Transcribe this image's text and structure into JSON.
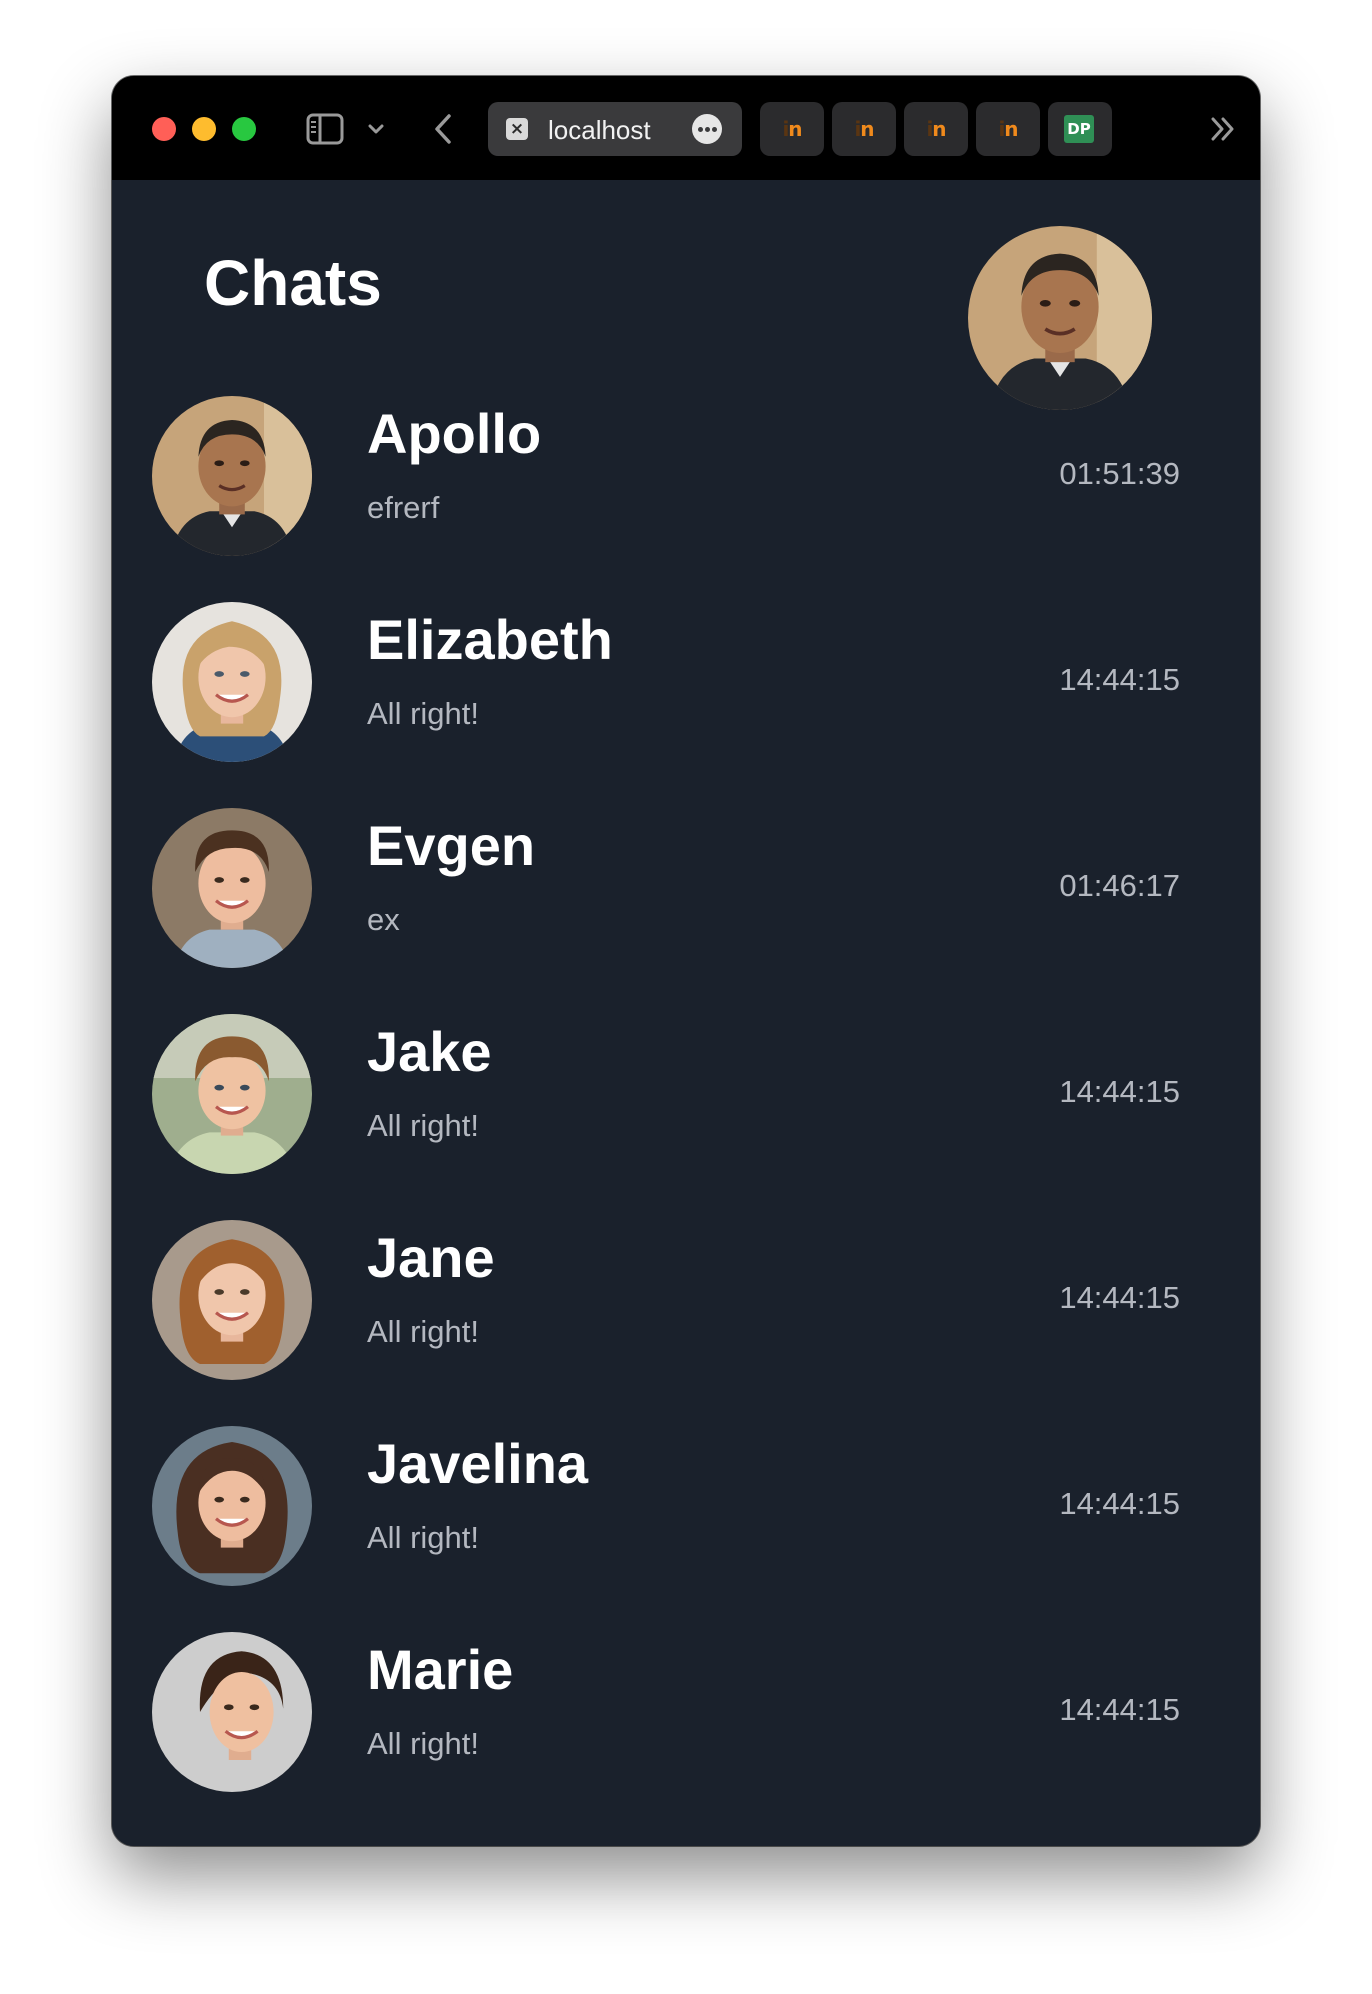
{
  "browser": {
    "active_tab": {
      "title": "localhost",
      "favicon": "close-x-icon"
    },
    "pinned_tabs": [
      {
        "icon": "invision-icon"
      },
      {
        "icon": "invision-icon"
      },
      {
        "icon": "invision-icon"
      },
      {
        "icon": "invision-icon"
      },
      {
        "icon": "dp-icon",
        "label": "DP"
      }
    ],
    "colors": {
      "titlebar": "#000000",
      "close": "#ff5f57",
      "minimize": "#febc2e",
      "zoom": "#28c840"
    }
  },
  "page": {
    "title": "Chats",
    "background": "#1a212c"
  },
  "chats": [
    {
      "name": "Apollo",
      "preview": "efrerf",
      "time": "01:51:39"
    },
    {
      "name": "Elizabeth",
      "preview": "All right!",
      "time": "14:44:15"
    },
    {
      "name": "Evgen",
      "preview": "ex",
      "time": "01:46:17"
    },
    {
      "name": "Jake",
      "preview": "All right!",
      "time": "14:44:15"
    },
    {
      "name": "Jane",
      "preview": "All right!",
      "time": "14:44:15"
    },
    {
      "name": "Javelina",
      "preview": "All right!",
      "time": "14:44:15"
    },
    {
      "name": "Marie",
      "preview": "All right!",
      "time": "14:44:15"
    }
  ]
}
